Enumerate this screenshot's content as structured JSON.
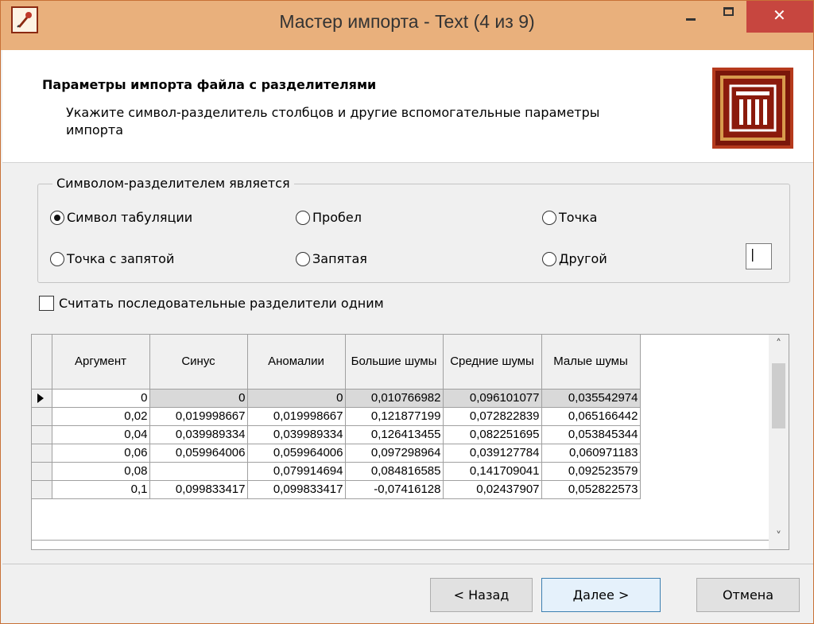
{
  "window": {
    "title": "Мастер импорта - Text (4 из 9)",
    "close_glyph": "✕",
    "accent_color": "#e9b07c",
    "close_color": "#c7463f"
  },
  "header": {
    "title": "Параметры импорта файла с разделителями",
    "description": "Укажите символ-разделитель столбцов и другие вспомогательные параметры импорта"
  },
  "delimiter_group": {
    "legend": "Символом-разделителем является",
    "options": [
      {
        "label": "Символ табуляции",
        "checked": true
      },
      {
        "label": "Пробел",
        "checked": false
      },
      {
        "label": "Точка",
        "checked": false
      },
      {
        "label": "Точка с запятой",
        "checked": false
      },
      {
        "label": "Запятая",
        "checked": false
      },
      {
        "label": "Другой",
        "checked": false
      }
    ],
    "other_value": "|"
  },
  "consecutive_checkbox": {
    "label": "Считать последовательные разделители одним",
    "checked": false
  },
  "grid": {
    "columns": [
      "Аргумент",
      "Синус",
      "Аномалии",
      "Большие шумы",
      "Средние шумы",
      "Малые шумы"
    ],
    "rows": [
      [
        "0",
        "0",
        "0",
        "0,010766982",
        "0,096101077",
        "0,035542974"
      ],
      [
        "0,02",
        "0,019998667",
        "0,019998667",
        "0,121877199",
        "0,072822839",
        "0,065166442"
      ],
      [
        "0,04",
        "0,039989334",
        "0,039989334",
        "0,126413455",
        "0,082251695",
        "0,053845344"
      ],
      [
        "0,06",
        "0,059964006",
        "0,059964006",
        "0,097298964",
        "0,039127784",
        "0,060971183"
      ],
      [
        "0,08",
        "",
        "0,079914694",
        "0,084816585",
        "0,141709041",
        "0,092523579"
      ],
      [
        "0,1",
        "0,099833417",
        "0,099833417",
        "-0,07416128",
        "0,02437907",
        "0,052822573"
      ]
    ],
    "scroll_up": "˄",
    "scroll_down": "˅"
  },
  "buttons": {
    "back": "< Назад",
    "next": "Далее >",
    "cancel": "Отмена"
  }
}
